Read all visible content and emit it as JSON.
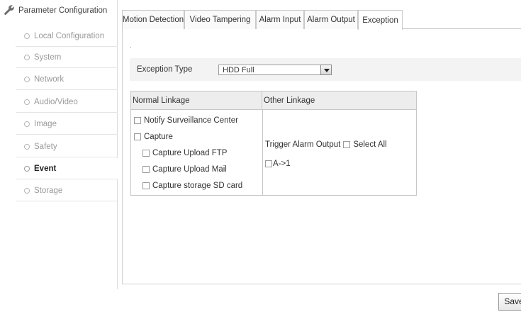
{
  "sidebar": {
    "title": "Parameter Configuration",
    "items": [
      {
        "label": "Local Configuration"
      },
      {
        "label": "System"
      },
      {
        "label": "Network"
      },
      {
        "label": "Audio/Video"
      },
      {
        "label": "Image"
      },
      {
        "label": "Safety"
      },
      {
        "label": "Event",
        "active": true
      },
      {
        "label": "Storage"
      }
    ]
  },
  "tabs": [
    {
      "label": "Motion Detection"
    },
    {
      "label": "Video Tampering"
    },
    {
      "label": "Alarm Input"
    },
    {
      "label": "Alarm Output"
    },
    {
      "label": "Exception",
      "active": true
    }
  ],
  "main": {
    "marker": ".",
    "exception_type_label": "Exception Type",
    "exception_type_value": "HDD Full"
  },
  "linkage": {
    "normal_header": "Normal Linkage",
    "other_header": "Other Linkage",
    "notify_center": "Notify Surveillance Center",
    "capture": "Capture",
    "capture_ftp": "Capture Upload FTP",
    "capture_mail": "Capture Upload Mail",
    "capture_sd": "Capture storage SD card",
    "trigger_alarm_output": "Trigger Alarm Output",
    "select_all": "Select All",
    "output_a1": "A->1"
  },
  "footer": {
    "save_label": "Save"
  }
}
